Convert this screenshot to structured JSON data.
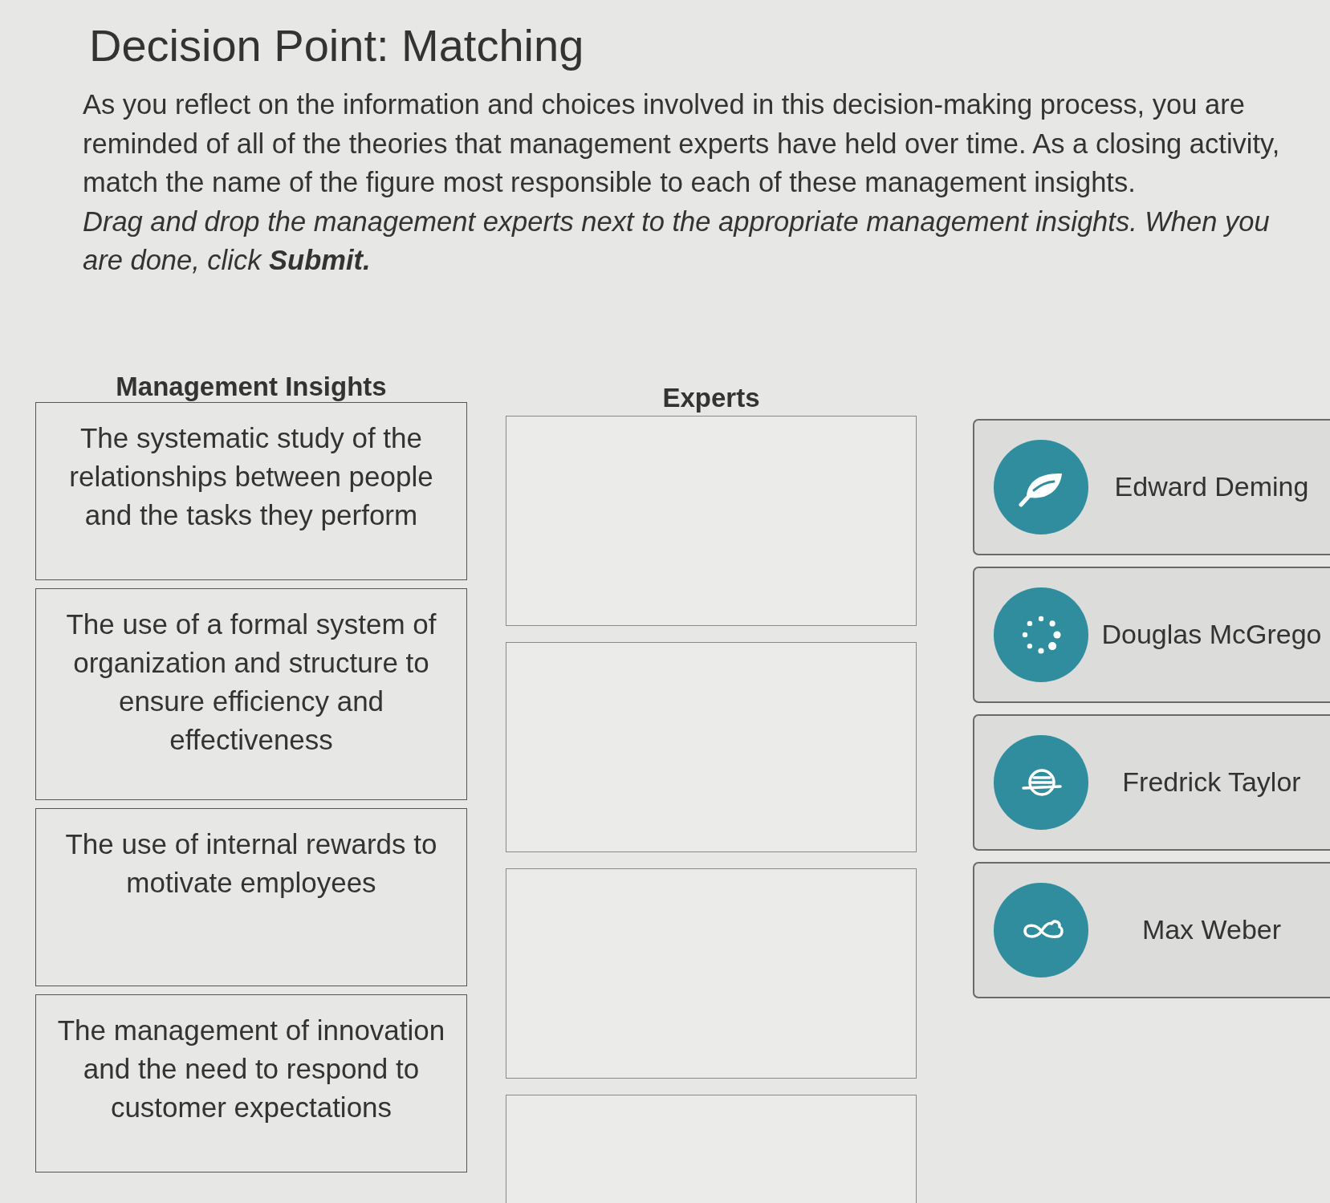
{
  "title": "Decision Point: Matching",
  "intro": "As you reflect on the information and choices involved in this decision-making process, you are reminded of all of the theories that management experts have held over time. As a closing activity, match the name of the figure most responsible to each of these management insights.",
  "instructions": "Drag and drop the management experts next to the appropriate management insights. When you are done, click **Submit.**",
  "insights": {
    "heading": "Management Insights",
    "items": [
      "The systematic study of the relationships between people and the tasks they perform",
      "The use of a formal system of organization and structure to ensure efficiency and effectiveness",
      "The use of internal rewards to motivate employees",
      "The management of innovation and the need to respond to customer expectations"
    ]
  },
  "answer_column": {
    "heading": "Experts"
  },
  "experts": [
    {
      "name": "Edward Deming"
    },
    {
      "name": "Douglas McGrego"
    },
    {
      "name": "Fredrick Taylor"
    },
    {
      "name": "Max Weber"
    }
  ]
}
